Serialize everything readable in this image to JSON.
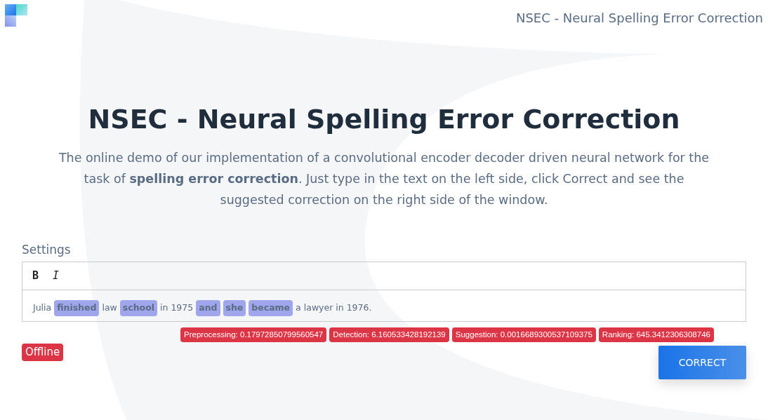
{
  "header": {
    "title": "NSEC - Neural Spelling Error Correction"
  },
  "hero": {
    "title": "NSEC - Neural Spelling Error Correction",
    "description": "The online demo of our implementation of a convolutional encoder decoder driven neural network for the task of **spelling error correction**. Just type in the text on the left side, click Correct and see the suggested correction on the right side of the window."
  },
  "settings_label": "Settings",
  "toolbar": [
    "B",
    "I"
  ],
  "editor_tokens": [
    {
      "text": "Julia",
      "highlighted": false
    },
    {
      "text": "finished",
      "highlighted": true
    },
    {
      "text": "law",
      "highlighted": false
    },
    {
      "text": "school",
      "highlighted": true
    },
    {
      "text": "in 1975",
      "highlighted": false
    },
    {
      "text": "and",
      "highlighted": true
    },
    {
      "text": "she",
      "highlighted": true
    },
    {
      "text": "became",
      "highlighted": true
    },
    {
      "text": "a lawyer in 1976.",
      "highlighted": false
    }
  ],
  "timings": [
    "Preprocessing: 0.17972850799560547",
    "Detection: 6.160533428192139",
    "Suggestion: 0.0016689300537109375",
    "Ranking: 645.3412306308746"
  ],
  "status": "Offline",
  "correct_button": "CORRECT"
}
